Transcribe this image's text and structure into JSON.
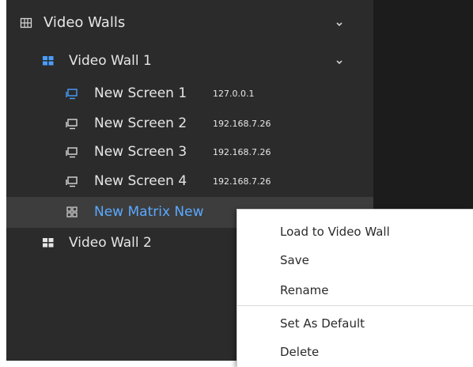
{
  "tree": {
    "root": {
      "label": "Video Walls",
      "icon": "video-walls-icon"
    },
    "walls": [
      {
        "label": "Video Wall 1",
        "icon": "video-wall-icon",
        "expanded": true,
        "screens": [
          {
            "label": "New Screen 1",
            "ip": "127.0.0.1",
            "icon": "monitor-icon",
            "accent": "#4a9eff"
          },
          {
            "label": "New Screen 2",
            "ip": "192.168.7.26",
            "icon": "monitor-icon"
          },
          {
            "label": "New Screen 3",
            "ip": "192.168.7.26",
            "icon": "monitor-icon"
          },
          {
            "label": "New Screen 4",
            "ip": "192.168.7.26",
            "icon": "monitor-icon"
          }
        ],
        "matrix": {
          "label": "New Matrix New",
          "icon": "matrix-grid-icon",
          "color": "#5aa9ff"
        }
      },
      {
        "label": "Video Wall 2",
        "icon": "video-wall-icon",
        "expanded": false
      }
    ]
  },
  "context_menu": {
    "items": [
      {
        "label": "Load to Video Wall"
      },
      {
        "label": "Save"
      },
      {
        "label": "Rename"
      },
      {
        "label": "Set As Default"
      },
      {
        "label": "Delete"
      }
    ]
  },
  "colors": {
    "panel_bg": "#2b2b2b",
    "dark_area": "#1c1c1c",
    "selected_row": "#3d3d3d",
    "accent_blue": "#4a9eff"
  }
}
